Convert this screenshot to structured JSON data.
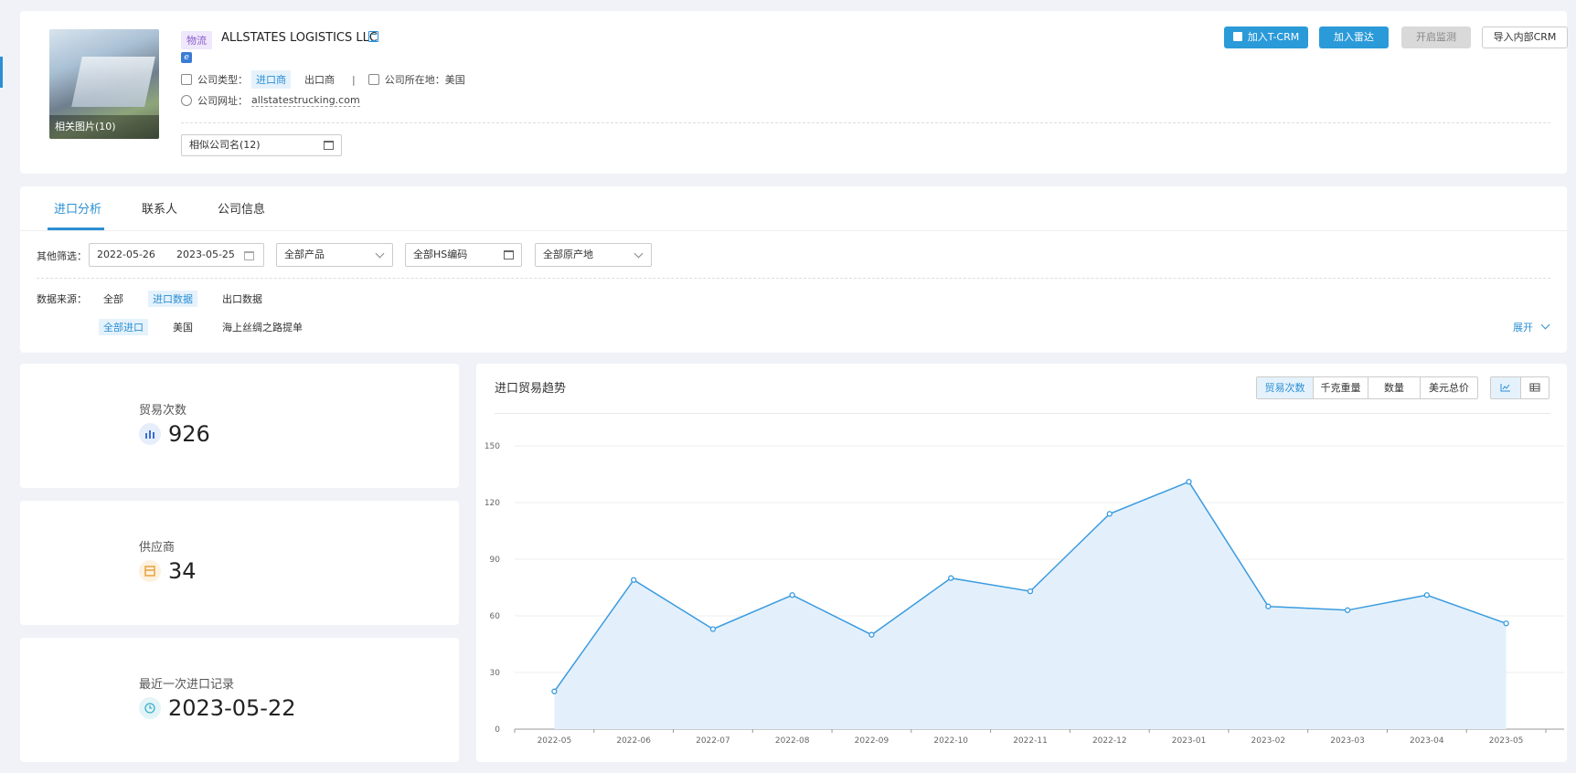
{
  "header": {
    "industry_tag": "物流",
    "company_name": "ALLSTATES LOGISTICS LLC",
    "photo_caption": "相关图片(10)",
    "company_type_label": "公司类型：",
    "type_importer": "进口商",
    "type_exporter": "出口商",
    "location_label": "公司所在地：",
    "location_value": "美国",
    "website_label": "公司网址：",
    "website_value": "allstatestrucking.com",
    "similar_names": "相似公司名(12)",
    "buttons": {
      "tcrm": "加入T-CRM",
      "radar": "加入雷达",
      "monitor": "开启监测",
      "import_crm": "导入内部CRM"
    }
  },
  "tabs": [
    "进口分析",
    "联系人",
    "公司信息"
  ],
  "filters": {
    "label": "其他筛选：",
    "date_start": "2022-05-26",
    "date_end": "2023-05-25",
    "product": "全部产品",
    "hs_code": "全部HS编码",
    "origin": "全部原产地",
    "source_label": "数据来源：",
    "sources": [
      "全部",
      "进口数据",
      "出口数据"
    ],
    "sub_sources": [
      "全部进口",
      "美国",
      "海上丝绸之路提单"
    ],
    "expand": "展开"
  },
  "stats": {
    "trades_label": "贸易次数",
    "trades_value": "926",
    "suppliers_label": "供应商",
    "suppliers_value": "34",
    "last_label": "最近一次进口记录",
    "last_value": "2023-05-22"
  },
  "chart_panel": {
    "title": "进口贸易趋势",
    "metrics": [
      "贸易次数",
      "千克重量",
      "数量",
      "美元总价"
    ]
  },
  "colors": {
    "accent": "#2b9ad9",
    "line": "#3a9be0",
    "area": "#e3f0fb"
  },
  "chart_data": {
    "type": "area",
    "categories": [
      "2022-05",
      "2022-06",
      "2022-07",
      "2022-08",
      "2022-09",
      "2022-10",
      "2022-11",
      "2022-12",
      "2023-01",
      "2023-02",
      "2023-03",
      "2023-04",
      "2023-05"
    ],
    "values": [
      20,
      79,
      53,
      71,
      50,
      80,
      73,
      114,
      131,
      65,
      63,
      71,
      56
    ],
    "yticks": [
      0,
      30,
      60,
      90,
      120,
      150
    ],
    "ylim": [
      0,
      150
    ],
    "grid": true
  }
}
